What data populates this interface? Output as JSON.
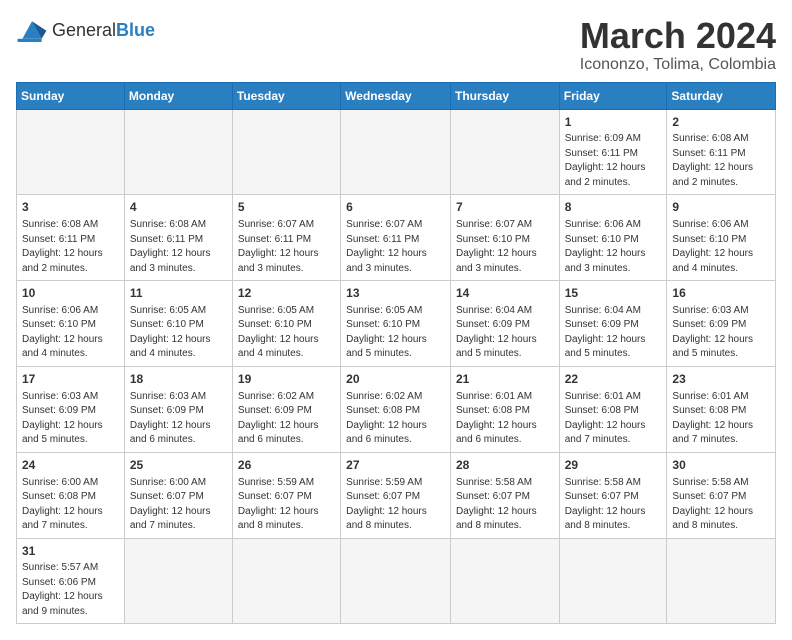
{
  "header": {
    "logo_general": "General",
    "logo_blue": "Blue",
    "month_title": "March 2024",
    "location": "Icononzo, Tolima, Colombia"
  },
  "days_of_week": [
    "Sunday",
    "Monday",
    "Tuesday",
    "Wednesday",
    "Thursday",
    "Friday",
    "Saturday"
  ],
  "weeks": [
    [
      {
        "day": "",
        "info": "",
        "empty": true
      },
      {
        "day": "",
        "info": "",
        "empty": true
      },
      {
        "day": "",
        "info": "",
        "empty": true
      },
      {
        "day": "",
        "info": "",
        "empty": true
      },
      {
        "day": "",
        "info": "",
        "empty": true
      },
      {
        "day": "1",
        "info": "Sunrise: 6:09 AM\nSunset: 6:11 PM\nDaylight: 12 hours\nand 2 minutes."
      },
      {
        "day": "2",
        "info": "Sunrise: 6:08 AM\nSunset: 6:11 PM\nDaylight: 12 hours\nand 2 minutes."
      }
    ],
    [
      {
        "day": "3",
        "info": "Sunrise: 6:08 AM\nSunset: 6:11 PM\nDaylight: 12 hours\nand 2 minutes."
      },
      {
        "day": "4",
        "info": "Sunrise: 6:08 AM\nSunset: 6:11 PM\nDaylight: 12 hours\nand 3 minutes."
      },
      {
        "day": "5",
        "info": "Sunrise: 6:07 AM\nSunset: 6:11 PM\nDaylight: 12 hours\nand 3 minutes."
      },
      {
        "day": "6",
        "info": "Sunrise: 6:07 AM\nSunset: 6:11 PM\nDaylight: 12 hours\nand 3 minutes."
      },
      {
        "day": "7",
        "info": "Sunrise: 6:07 AM\nSunset: 6:10 PM\nDaylight: 12 hours\nand 3 minutes."
      },
      {
        "day": "8",
        "info": "Sunrise: 6:06 AM\nSunset: 6:10 PM\nDaylight: 12 hours\nand 3 minutes."
      },
      {
        "day": "9",
        "info": "Sunrise: 6:06 AM\nSunset: 6:10 PM\nDaylight: 12 hours\nand 4 minutes."
      }
    ],
    [
      {
        "day": "10",
        "info": "Sunrise: 6:06 AM\nSunset: 6:10 PM\nDaylight: 12 hours\nand 4 minutes."
      },
      {
        "day": "11",
        "info": "Sunrise: 6:05 AM\nSunset: 6:10 PM\nDaylight: 12 hours\nand 4 minutes."
      },
      {
        "day": "12",
        "info": "Sunrise: 6:05 AM\nSunset: 6:10 PM\nDaylight: 12 hours\nand 4 minutes."
      },
      {
        "day": "13",
        "info": "Sunrise: 6:05 AM\nSunset: 6:10 PM\nDaylight: 12 hours\nand 5 minutes."
      },
      {
        "day": "14",
        "info": "Sunrise: 6:04 AM\nSunset: 6:09 PM\nDaylight: 12 hours\nand 5 minutes."
      },
      {
        "day": "15",
        "info": "Sunrise: 6:04 AM\nSunset: 6:09 PM\nDaylight: 12 hours\nand 5 minutes."
      },
      {
        "day": "16",
        "info": "Sunrise: 6:03 AM\nSunset: 6:09 PM\nDaylight: 12 hours\nand 5 minutes."
      }
    ],
    [
      {
        "day": "17",
        "info": "Sunrise: 6:03 AM\nSunset: 6:09 PM\nDaylight: 12 hours\nand 5 minutes."
      },
      {
        "day": "18",
        "info": "Sunrise: 6:03 AM\nSunset: 6:09 PM\nDaylight: 12 hours\nand 6 minutes."
      },
      {
        "day": "19",
        "info": "Sunrise: 6:02 AM\nSunset: 6:09 PM\nDaylight: 12 hours\nand 6 minutes."
      },
      {
        "day": "20",
        "info": "Sunrise: 6:02 AM\nSunset: 6:08 PM\nDaylight: 12 hours\nand 6 minutes."
      },
      {
        "day": "21",
        "info": "Sunrise: 6:01 AM\nSunset: 6:08 PM\nDaylight: 12 hours\nand 6 minutes."
      },
      {
        "day": "22",
        "info": "Sunrise: 6:01 AM\nSunset: 6:08 PM\nDaylight: 12 hours\nand 7 minutes."
      },
      {
        "day": "23",
        "info": "Sunrise: 6:01 AM\nSunset: 6:08 PM\nDaylight: 12 hours\nand 7 minutes."
      }
    ],
    [
      {
        "day": "24",
        "info": "Sunrise: 6:00 AM\nSunset: 6:08 PM\nDaylight: 12 hours\nand 7 minutes."
      },
      {
        "day": "25",
        "info": "Sunrise: 6:00 AM\nSunset: 6:07 PM\nDaylight: 12 hours\nand 7 minutes."
      },
      {
        "day": "26",
        "info": "Sunrise: 5:59 AM\nSunset: 6:07 PM\nDaylight: 12 hours\nand 8 minutes."
      },
      {
        "day": "27",
        "info": "Sunrise: 5:59 AM\nSunset: 6:07 PM\nDaylight: 12 hours\nand 8 minutes."
      },
      {
        "day": "28",
        "info": "Sunrise: 5:58 AM\nSunset: 6:07 PM\nDaylight: 12 hours\nand 8 minutes."
      },
      {
        "day": "29",
        "info": "Sunrise: 5:58 AM\nSunset: 6:07 PM\nDaylight: 12 hours\nand 8 minutes."
      },
      {
        "day": "30",
        "info": "Sunrise: 5:58 AM\nSunset: 6:07 PM\nDaylight: 12 hours\nand 8 minutes."
      }
    ],
    [
      {
        "day": "31",
        "info": "Sunrise: 5:57 AM\nSunset: 6:06 PM\nDaylight: 12 hours\nand 9 minutes."
      },
      {
        "day": "",
        "info": "",
        "empty": true
      },
      {
        "day": "",
        "info": "",
        "empty": true
      },
      {
        "day": "",
        "info": "",
        "empty": true
      },
      {
        "day": "",
        "info": "",
        "empty": true
      },
      {
        "day": "",
        "info": "",
        "empty": true
      },
      {
        "day": "",
        "info": "",
        "empty": true
      }
    ]
  ]
}
